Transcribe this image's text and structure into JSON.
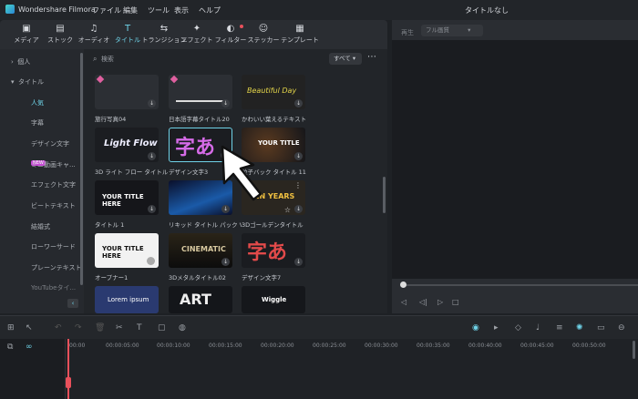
{
  "app": {
    "name": "Wondershare Filmora",
    "project_title": "タイトルなし"
  },
  "menu": [
    "ファイル",
    "編集",
    "ツール",
    "表示",
    "ヘルプ"
  ],
  "toolbar": [
    {
      "label": "メディア",
      "icon": "media-icon"
    },
    {
      "label": "ストック",
      "icon": "stock-icon"
    },
    {
      "label": "オーディオ",
      "icon": "audio-icon"
    },
    {
      "label": "タイトル",
      "icon": "title-icon",
      "active": true
    },
    {
      "label": "トランジション",
      "icon": "transition-icon"
    },
    {
      "label": "エフェクト",
      "icon": "effect-icon"
    },
    {
      "label": "フィルター",
      "icon": "filter-icon"
    },
    {
      "label": "ステッカー",
      "icon": "sticker-icon"
    },
    {
      "label": "テンプレート",
      "icon": "template-icon"
    }
  ],
  "sidebar": {
    "sections": [
      "個人",
      "タイトル"
    ],
    "items": [
      "人気",
      "字幕",
      "デザイン文字",
      "ミニ動画キャ...",
      "エフェクト文字",
      "ビートテキスト",
      "結婚式",
      "ローワーサード",
      "プレーンテキスト",
      "YouTubeタイ..."
    ],
    "badge": "NEW"
  },
  "search": {
    "placeholder": "検索",
    "filter": "すべて"
  },
  "cards": [
    {
      "label": "旅行写真04",
      "thumb": ""
    },
    {
      "label": "日本語字幕タイトル20",
      "thumb": ""
    },
    {
      "label": "かわいい葉えるテキスト",
      "thumb": "Beautiful Day"
    },
    {
      "label": "3D ライト フロー タイトル",
      "thumb": "Light Flow"
    },
    {
      "label": "デザイン文字3",
      "thumb": "字あ"
    },
    {
      "label": "粒子バック タイトル 11",
      "thumb": "YOUR TITLE"
    },
    {
      "label": "タイトル 1",
      "thumb": "YOUR TITLE HERE"
    },
    {
      "label": "リキッド タイトル パック Vo...",
      "thumb": ""
    },
    {
      "label": "3Dゴールデンタイトル",
      "thumb": "EN YEARS"
    },
    {
      "label": "オープナー1",
      "thumb": "YOUR TITLE HERE"
    },
    {
      "label": "3Dメタルタイトル02",
      "thumb": "CINEMATIC"
    },
    {
      "label": "デザイン文字7",
      "thumb": "字あ"
    },
    {
      "label": "",
      "thumb": "Lorem ipsum"
    },
    {
      "label": "",
      "thumb": "ART"
    },
    {
      "label": "",
      "thumb": "Wiggle"
    }
  ],
  "preview": {
    "label": "再生",
    "quality": "フル画質"
  },
  "timeline": {
    "ticks": [
      "00:00",
      "00:00:05:00",
      "00:00:10:00",
      "00:00:15:00",
      "00:00:20:00",
      "00:00:25:00",
      "00:00:30:00",
      "00:00:35:00",
      "00:00:40:00",
      "00:00:45:00",
      "00:00:50:00"
    ]
  },
  "colors": {
    "accent": "#6fd3e8",
    "playhead": "#e8505b",
    "badge": "#c74bd6"
  }
}
